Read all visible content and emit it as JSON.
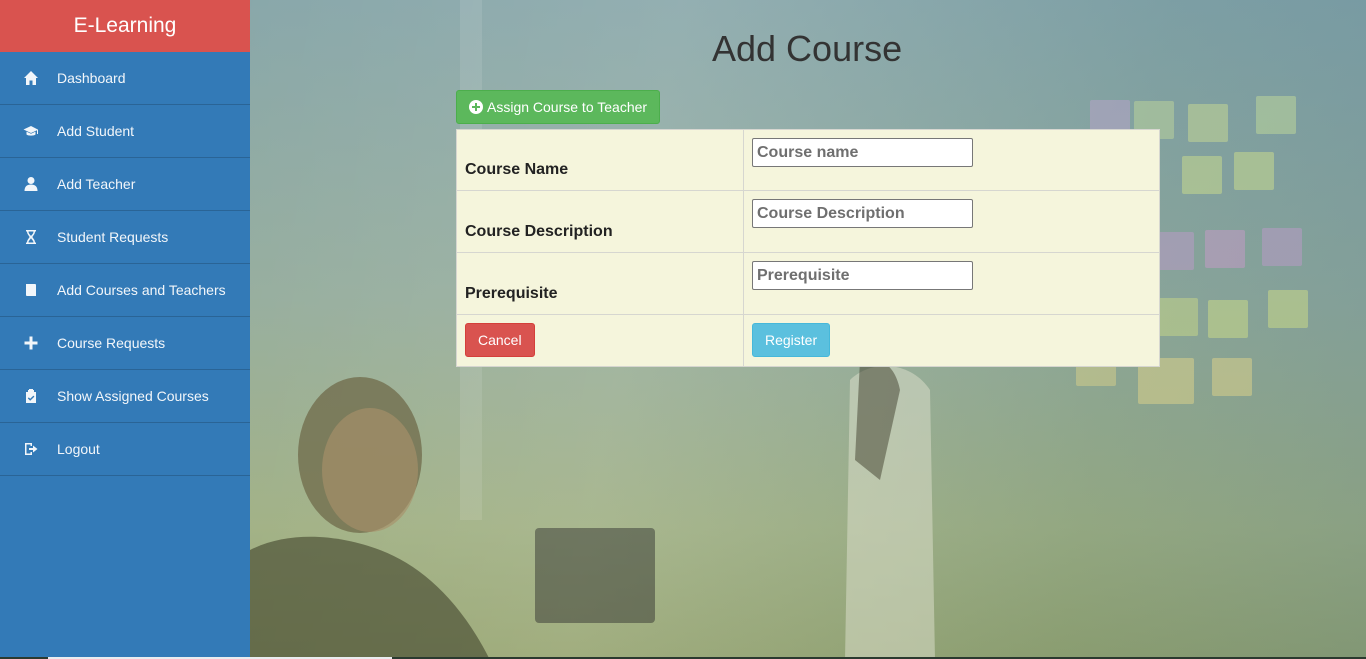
{
  "app": {
    "brand": "E-Learning"
  },
  "sidebar": {
    "items": [
      {
        "label": "Dashboard",
        "icon": "home-icon"
      },
      {
        "label": "Add Student",
        "icon": "graduation-cap-icon"
      },
      {
        "label": "Add Teacher",
        "icon": "user-icon"
      },
      {
        "label": "Student Requests",
        "icon": "hourglass-icon"
      },
      {
        "label": "Add Courses and Teachers",
        "icon": "book-icon"
      },
      {
        "label": "Course Requests",
        "icon": "plus-icon"
      },
      {
        "label": "Show Assigned Courses",
        "icon": "clipboard-icon"
      },
      {
        "label": "Logout",
        "icon": "logout-icon"
      }
    ]
  },
  "main": {
    "title": "Add Course",
    "assign_button": "Assign Course to Teacher",
    "form": {
      "course_name": {
        "label": "Course Name",
        "placeholder": "Course name",
        "value": ""
      },
      "course_description": {
        "label": "Course Description",
        "placeholder": "Course Description",
        "value": ""
      },
      "prerequisite": {
        "label": "Prerequisite",
        "placeholder": "Prerequisite",
        "value": ""
      },
      "cancel_label": "Cancel",
      "register_label": "Register"
    }
  },
  "colors": {
    "brand_bg": "#d9534f",
    "sidebar_bg": "#337ab7",
    "assign_button": "#5cb85c",
    "cancel_button": "#d9534f",
    "register_button": "#5bc0de",
    "form_bg": "#f5f5dc"
  }
}
